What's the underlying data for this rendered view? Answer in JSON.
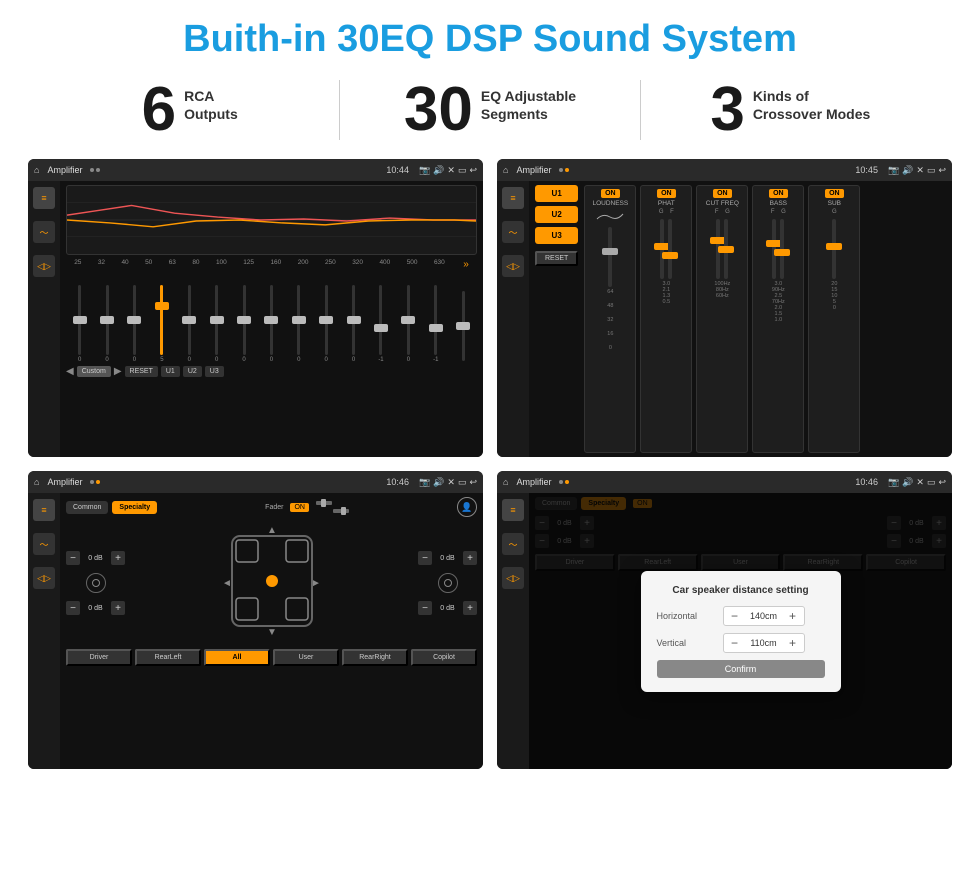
{
  "header": {
    "title": "Buith-in 30EQ DSP Sound System"
  },
  "stats": [
    {
      "number": "6",
      "label": "RCA\nOutputs"
    },
    {
      "number": "30",
      "label": "EQ Adjustable\nSegments"
    },
    {
      "number": "3",
      "label": "Kinds of\nCrossover Modes"
    }
  ],
  "screens": [
    {
      "id": "screen1",
      "topbar": {
        "title": "Amplifier",
        "time": "10:44"
      },
      "type": "eq"
    },
    {
      "id": "screen2",
      "topbar": {
        "title": "Amplifier",
        "time": "10:45"
      },
      "type": "adv-eq"
    },
    {
      "id": "screen3",
      "topbar": {
        "title": "Amplifier",
        "time": "10:46"
      },
      "type": "speaker"
    },
    {
      "id": "screen4",
      "topbar": {
        "title": "Amplifier",
        "time": "10:46"
      },
      "type": "speaker-dialog"
    }
  ],
  "eq": {
    "freqs": [
      "25",
      "32",
      "40",
      "50",
      "63",
      "80",
      "100",
      "125",
      "160",
      "200",
      "250",
      "320",
      "400",
      "500",
      "630"
    ],
    "values": [
      "0",
      "0",
      "0",
      "5",
      "0",
      "0",
      "0",
      "0",
      "0",
      "0",
      "0",
      "-1",
      "0",
      "-1",
      ""
    ],
    "buttons": [
      "Custom",
      "RESET",
      "U1",
      "U2",
      "U3"
    ]
  },
  "adv_eq": {
    "presets": [
      "U1",
      "U2",
      "U3"
    ],
    "modules": [
      {
        "name": "LOUDNESS",
        "on": true
      },
      {
        "name": "PHAT",
        "on": true
      },
      {
        "name": "CUT FREQ",
        "on": true
      },
      {
        "name": "BASS",
        "on": true
      },
      {
        "name": "SUB",
        "on": true
      }
    ],
    "reset": "RESET"
  },
  "speaker": {
    "tabs": [
      "Common",
      "Specialty"
    ],
    "active_tab": "Specialty",
    "fader_label": "Fader",
    "fader_on": "ON",
    "db_values": [
      "0 dB",
      "0 dB",
      "0 dB",
      "0 dB"
    ],
    "buttons": [
      "Driver",
      "RearLeft",
      "All",
      "User",
      "RearRight",
      "Copilot"
    ]
  },
  "dialog": {
    "title": "Car speaker distance setting",
    "horizontal_label": "Horizontal",
    "horizontal_value": "140cm",
    "vertical_label": "Vertical",
    "vertical_value": "110cm",
    "confirm_label": "Confirm"
  }
}
